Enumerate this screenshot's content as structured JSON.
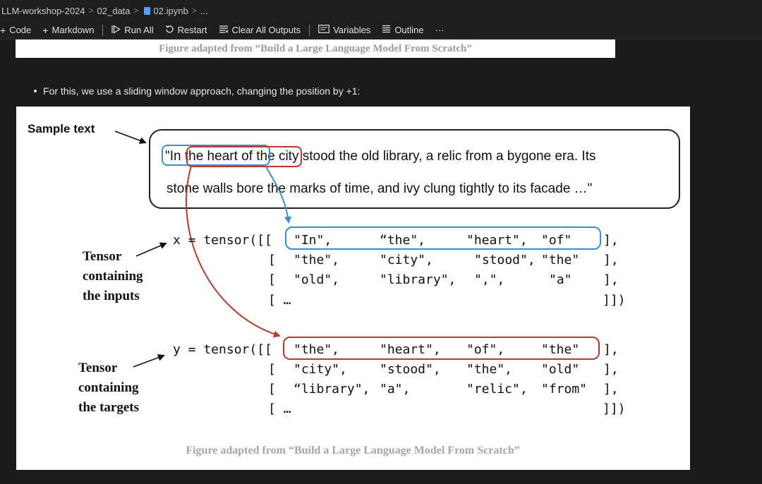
{
  "breadcrumb": {
    "items": [
      "LLM-workshop-2024",
      "02_data",
      "02.ipynb",
      "..."
    ],
    "separator": ">"
  },
  "toolbar": {
    "code_label": "Code",
    "markdown_label": "Markdown",
    "run_all_label": "Run All",
    "restart_label": "Restart",
    "clear_outputs_label": "Clear All Outputs",
    "variables_label": "Variables",
    "outline_label": "Outline",
    "more_label": "···"
  },
  "prev_figure": {
    "caption": "Figure adapted from “Build a Large Language Model From Scratch”"
  },
  "markdown": {
    "bullet": "For this, we use a sliding window approach, changing the position by +1:"
  },
  "figure": {
    "sample_text_label": "Sample text",
    "sample_line1": "\"In the heart of the city stood the old library, a relic from a bygone era. Its",
    "sample_line2": "stone walls bore the marks of time, and ivy clung tightly to its facade …\"",
    "inputs_label": [
      "Tensor",
      "containing",
      "the inputs"
    ],
    "targets_label": [
      "Tensor",
      "containing",
      "the targets"
    ],
    "x_prefix": "x = tensor([[",
    "y_prefix": "y = tensor([[",
    "x_rows": [
      [
        "\"In\",",
        "“the\",",
        "\"heart\",",
        "\"of\""
      ],
      [
        "\"the\",",
        "\"city\",",
        "\"stood\",",
        "\"the\""
      ],
      [
        "\"old\",",
        "\"library\",",
        "\",\",",
        "\"a\""
      ]
    ],
    "y_rows": [
      [
        "\"the\",",
        "\"heart\",",
        "\"of\",",
        "\"the\""
      ],
      [
        "\"city\",",
        "\"stood\",",
        "\"the\",",
        "\"old\""
      ],
      [
        "“library\",",
        "\"a\",",
        "\"relic\",",
        "\"from\""
      ]
    ],
    "row_end": "],",
    "row_open": "[",
    "ellipsis_row": "[ …",
    "tensor_end": "]])",
    "caption": "Figure adapted from “Build a Large Language Model From Scratch”"
  },
  "colors": {
    "blue_box": "#3a8fd0",
    "red_box": "#b83a2e"
  }
}
